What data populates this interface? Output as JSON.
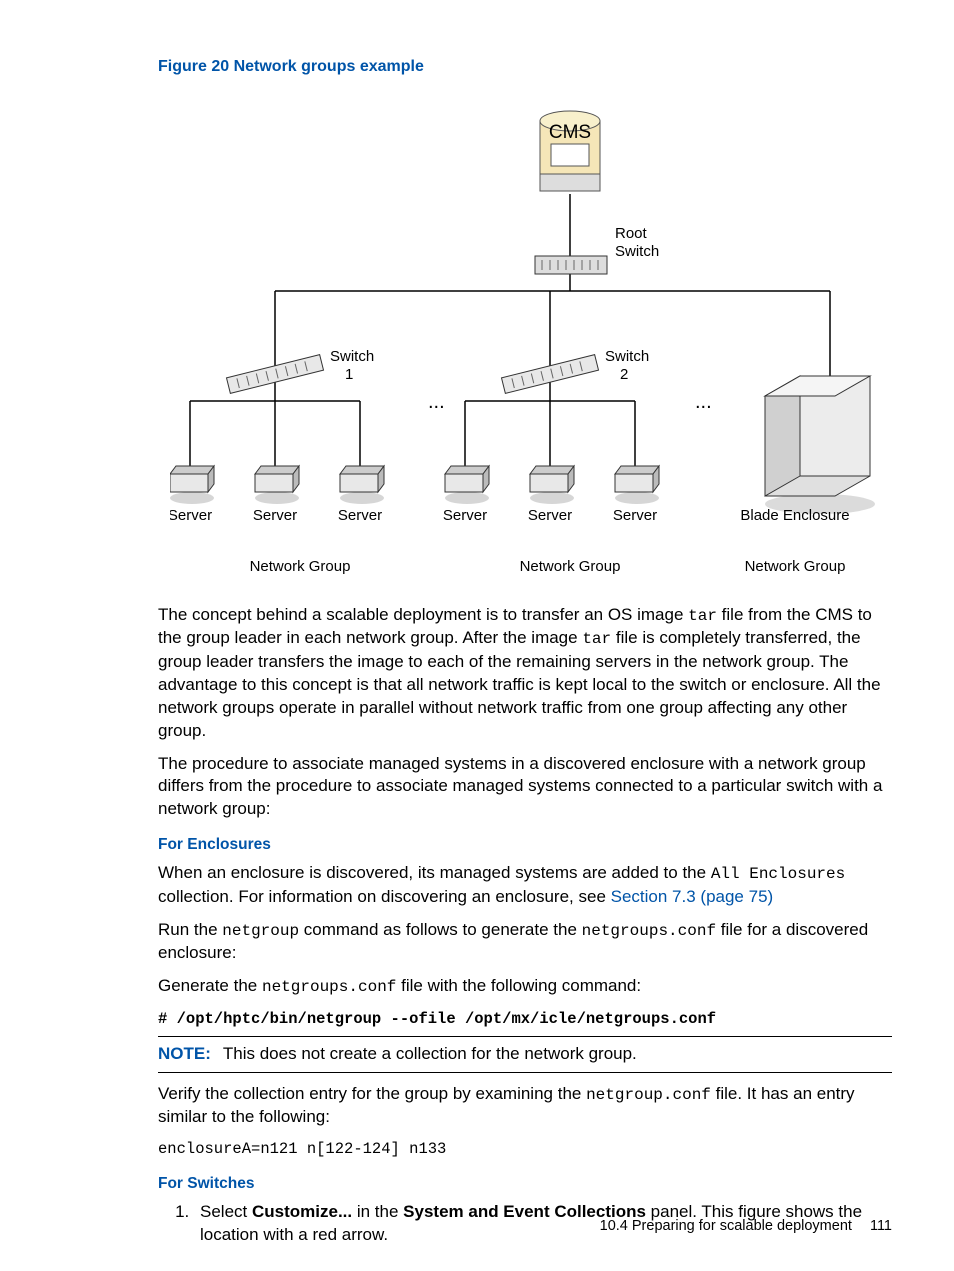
{
  "figure": {
    "caption": "Figure 20 Network groups example",
    "nodes": {
      "cms": "CMS",
      "root_switch_l1": "Root",
      "root_switch_l2": "Switch",
      "switch1_l1": "Switch",
      "switch1_l2": "1",
      "switch2_l1": "Switch",
      "switch2_l2": "2",
      "server": "Server",
      "blade": "Blade Enclosure",
      "group": "Network Group",
      "ell": "..."
    }
  },
  "body": {
    "p1a": "The concept behind a scalable deployment is to transfer an OS image ",
    "p1b": " file from the CMS to the group leader in each network group. After the image ",
    "p1c": " file is completely transferred, the group leader transfers the image to each of the remaining servers in the network group. The advantage to this concept is that all network traffic is kept local to the switch or enclosure. All the network groups operate in parallel without network traffic from one group affecting any other group.",
    "tar": "tar",
    "p2": "The procedure to associate managed systems in a discovered enclosure with a network group differs from the procedure to associate managed systems connected to a particular switch with a network group:",
    "sec_enc": "For Enclosures",
    "p3a": "When an enclosure is discovered, its managed systems are added to the ",
    "p3b": " collection. For information on discovering an enclosure, see ",
    "allenc": "All Enclosures",
    "link73": "Section 7.3 (page 75)",
    "p4a": "Run the ",
    "p4b": " command as follows to generate the ",
    "p4c": " file for a discovered enclosure:",
    "netgroup": "netgroup",
    "ngconf": "netgroups.conf",
    "p5a": "Generate the ",
    "p5b": " file with the following command:",
    "cmd1": "# /opt/hptc/bin/netgroup --ofile /opt/mx/icle/netgroups.conf",
    "note_lbl": "NOTE:",
    "note_txt": "This does not create a collection for the network group.",
    "p6a": "Verify the collection entry for the group by examining the ",
    "p6b": " file. It has an entry similar to the following:",
    "ngconf2": "netgroup.conf",
    "cmd2": "enclosureA=n121 n[122-124] n133",
    "sec_sw": "For Switches",
    "step1a": "Select ",
    "step1b": " in the ",
    "step1c": " panel. This figure shows the location with a red arrow.",
    "customize": "Customize...",
    "panel": "System and Event Collections"
  },
  "footer": {
    "section": "10.4 Preparing for scalable deployment",
    "page": "111"
  }
}
